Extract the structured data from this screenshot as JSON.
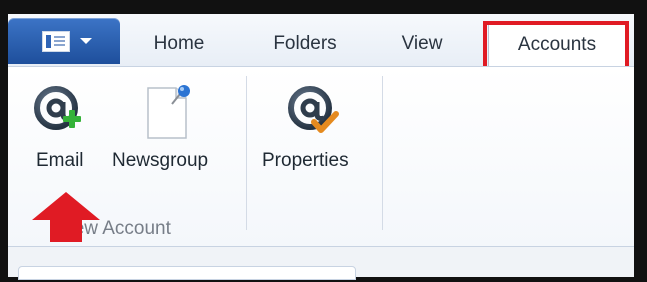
{
  "tabs": {
    "home": "Home",
    "folders": "Folders",
    "view": "View",
    "accounts": "Accounts"
  },
  "ribbon": {
    "email_label": "Email",
    "newsgroup_label": "Newsgroup",
    "properties_label": "Properties",
    "group_label": "New Account"
  },
  "icons": {
    "app_menu": "app-menu-icon",
    "email": "email-add-icon",
    "newsgroup": "newsgroup-icon",
    "properties": "properties-icon"
  },
  "colors": {
    "highlight": "#e01b24",
    "app_button": "#2a5fae",
    "active_tab_accent": "#e2a31c"
  }
}
